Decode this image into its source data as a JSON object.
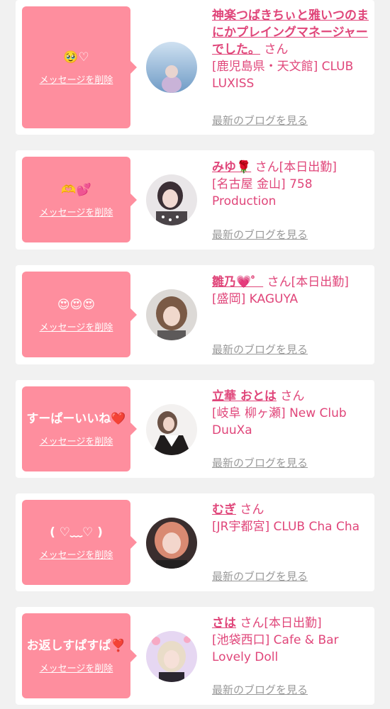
{
  "cards": [
    {
      "message": "🥹♡",
      "delete_label": "メッセージを削除",
      "name": "神楽つばきちぃと雅いつのまにかプレイングマネージャーでした。",
      "suffix": "さん",
      "shop": "[鹿児島県・天文館] CLUB LUXISS",
      "blog_label": "最新のブログを見る"
    },
    {
      "message": "🫶💕",
      "delete_label": "メッセージを削除",
      "name": "みゆ🌹",
      "suffix": "さん[本日出勤]",
      "shop": "[名古屋 金山] 758 Production",
      "blog_label": "最新のブログを見る"
    },
    {
      "message": "😍😍😍",
      "delete_label": "メッセージを削除",
      "name": "雛乃💗゜",
      "suffix": "さん[本日出勤]",
      "shop": "[盛岡] KAGUYA",
      "blog_label": "最新のブログを見る"
    },
    {
      "message": "すーぱーいいね❤️",
      "delete_label": "メッセージを削除",
      "name": "立華 おとは",
      "suffix": "さん",
      "shop": "[岐阜 柳ヶ瀬] New Club DuuXa",
      "blog_label": "最新のブログを見る"
    },
    {
      "message": "( ♡﹏♡ )",
      "delete_label": "メッセージを削除",
      "name": "むぎ",
      "suffix": "さん",
      "shop": "[JR宇都宮] CLUB Cha Cha",
      "blog_label": "最新のブログを見る"
    },
    {
      "message": "お返しすぱすぱ❣️",
      "delete_label": "メッセージを削除",
      "name": "さは",
      "suffix": "さん[本日出勤]",
      "shop": "[池袋西口] Cafe & Bar Lovely Doll",
      "blog_label": "最新のブログを見る"
    }
  ],
  "colors": {
    "page_bg": "#f1f1f1",
    "bubble": "#fe8e9e",
    "name_text": "#e0467a",
    "blog_link": "#9a9a9a"
  },
  "icons": [
    "avatar-photo"
  ]
}
